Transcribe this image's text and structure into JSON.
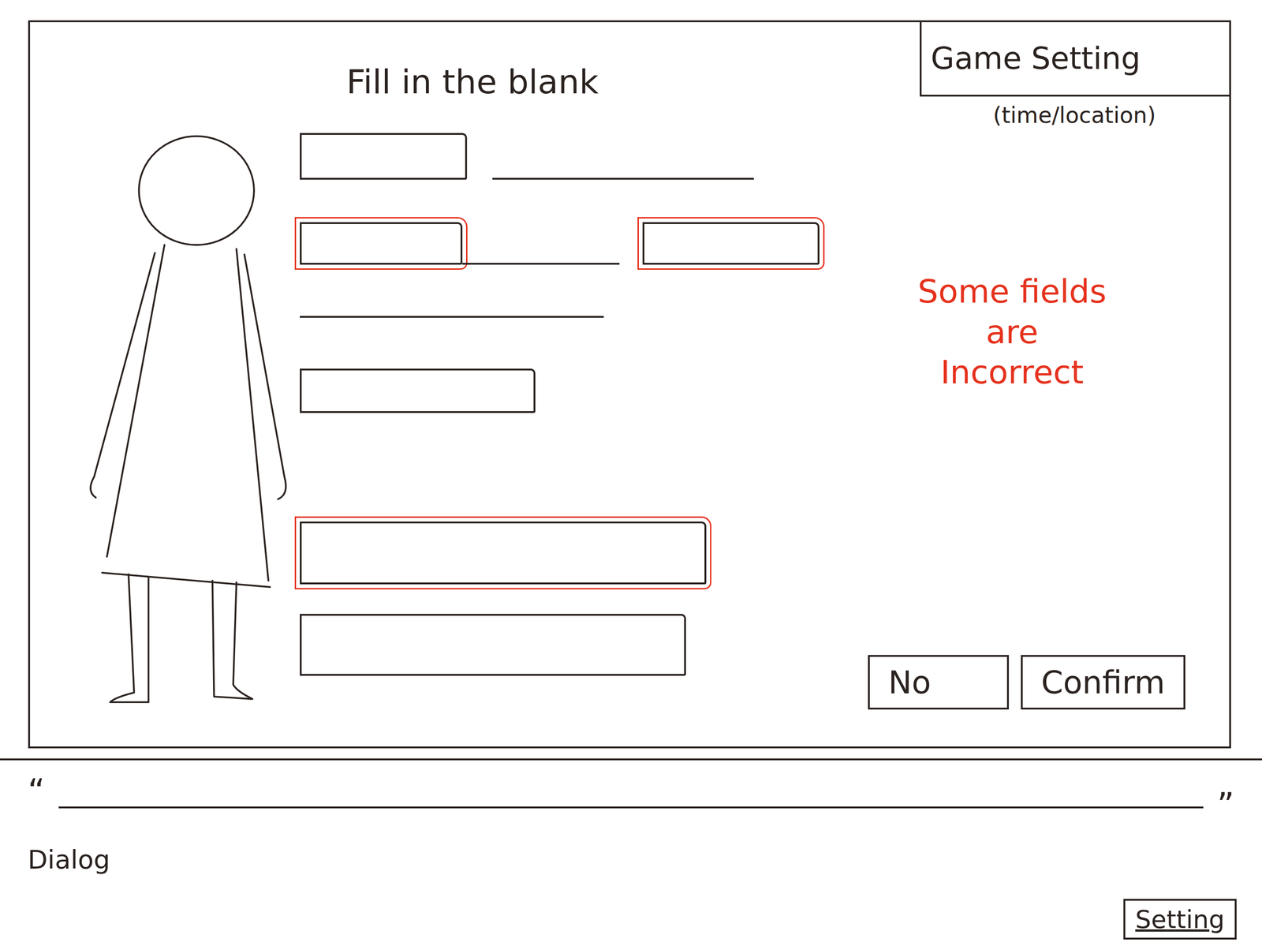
{
  "title": "Fill in the blank",
  "game_setting": {
    "label": "Game Setting",
    "subtitle": "(time/location)"
  },
  "rows": [
    {
      "fields": [
        {
          "kind": "box",
          "incorrect": false
        },
        {
          "kind": "line",
          "incorrect": false
        }
      ]
    },
    {
      "fields": [
        {
          "kind": "box",
          "incorrect": true
        },
        {
          "kind": "line",
          "incorrect": false
        },
        {
          "kind": "box",
          "incorrect": true
        }
      ]
    },
    {
      "fields": [
        {
          "kind": "line",
          "incorrect": false
        }
      ]
    },
    {
      "fields": [
        {
          "kind": "box",
          "incorrect": false
        }
      ]
    },
    {
      "fields": [
        {
          "kind": "box",
          "incorrect": true
        }
      ]
    },
    {
      "fields": [
        {
          "kind": "box",
          "incorrect": false
        }
      ]
    }
  ],
  "error": {
    "lines": [
      "Some fields",
      "are",
      "Incorrect"
    ]
  },
  "buttons": [
    {
      "label": "No"
    },
    {
      "label": "Confirm"
    }
  ],
  "dialog": {
    "open_quote": "“",
    "close_quote": "”",
    "label": "Dialog"
  },
  "settings_button": "Setting"
}
